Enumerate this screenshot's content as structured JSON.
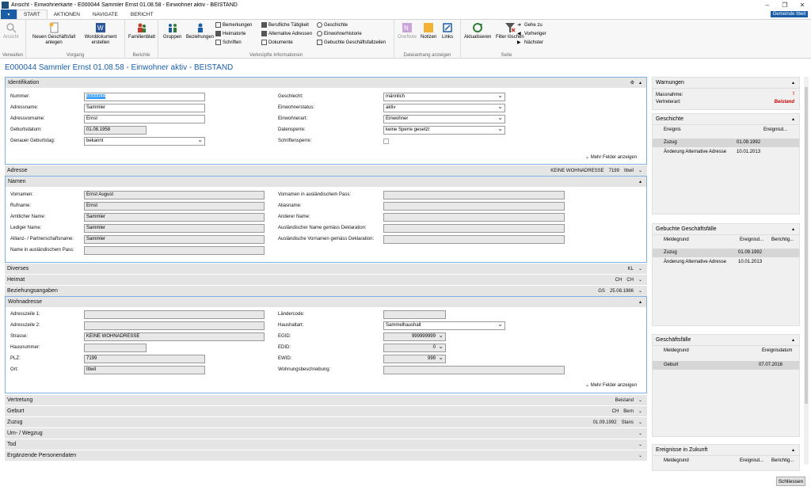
{
  "window": {
    "title": "Ansicht - Einwohnerkarte - E000044 Sammler Ernst 01.08.58 - Einwohner aktiv - BEISTAND",
    "gemeinde": "Gemeinde Ittwil"
  },
  "ribbon": {
    "tabs": [
      "START",
      "AKTIONEN",
      "NAVIGATE",
      "BERICHT"
    ],
    "groups": {
      "verwalten": {
        "label": "Verwalten",
        "ansicht": "Ansicht"
      },
      "vorgang": {
        "label": "Vorgang",
        "neu": "Neuen Geschäftsfall anlegen",
        "word": "Worddokument erstellen"
      },
      "berichte": {
        "label": "Berichte",
        "familienblatt": "Familienblatt"
      },
      "verkn": {
        "label": "Verknüpfte Informationen",
        "gruppen": "Gruppen",
        "beziehungen": "Beziehungen",
        "bemerkungen": "Bemerkungen",
        "heimatorte": "Heimatorte",
        "schriften": "Schriften",
        "taetigkeit": "Berufliche Tätigkeit",
        "altadressen": "Alternative Adressen",
        "dokumente": "Dokumente",
        "geschichte": "Geschichte",
        "einwohnerhistorie": "Einwohnerhistorie",
        "gebuchte": "Gebuchte Geschäftsfallzeilen"
      },
      "dateianhang": {
        "label": "Dateianhang anzeigen",
        "onenote": "OneNote",
        "notizen": "Notizen",
        "links": "Links"
      },
      "seite": {
        "label": "Seite",
        "aktualisieren": "Aktualisieren",
        "filter": "Filter löschen",
        "gehezu": "Gehe zu",
        "vorheriger": "Vorheriger",
        "naechster": "Nächster"
      }
    }
  },
  "page_title": "E000044 Sammler Ernst 01.08.58 - Einwohner aktiv - BEISTAND",
  "identifikation": {
    "title": "Identifikation",
    "nummer_label": "Nummer:",
    "nummer": "E000044",
    "adressname_label": "Adressname:",
    "adressname": "Sammler",
    "adressvorname_label": "Adressvorname:",
    "adressvorname": "Ernst",
    "geburtsdatum_label": "Geburtsdatum:",
    "geburtsdatum": "01.08.1958",
    "genauer_label": "Genauer Geburtstag:",
    "genauer": "bekannt",
    "geschlecht_label": "Geschlecht:",
    "geschlecht": "männlich",
    "status_label": "Einwohnerstatus:",
    "status": "aktiv",
    "art_label": "Einwohnerart:",
    "art": "Einwohner",
    "sperre_label": "Datensperre:",
    "sperre": "keine Sperre gesetzt",
    "schriftensperre_label": "Schriftensperre:",
    "mehr": "Mehr Felder anzeigen"
  },
  "adresse": {
    "title": "Adresse",
    "info": "KEINE WOHNADRESSE",
    "plz": "7199",
    "ort": "Ittwil"
  },
  "namen": {
    "title": "Namen",
    "vornamen_label": "Vornamen:",
    "vornamen": "Ernst August",
    "rufname_label": "Rufname:",
    "rufname": "Ernst",
    "amtlich_label": "Amtlicher Name:",
    "amtlich": "Sammler",
    "ledig_label": "Lediger Name:",
    "ledig": "Sammler",
    "allianz_label": "Allianz- / Partnerschaftsname:",
    "allianz": "Sammler",
    "pass_label": "Name in ausländischem Pass:",
    "vornamen_pass_label": "Vornamen in ausländischem Pass:",
    "alias_label": "Aliasname:",
    "anderer_label": "Anderer Name:",
    "ausl_name_label": "Ausländischer Name gemäss Deklaration:",
    "ausl_vornamen_label": "Ausländische Vornamen gemäss Deklaration:"
  },
  "diverses": {
    "title": "Diverses",
    "info": "KL"
  },
  "heimat": {
    "title": "Heimat",
    "a": "CH",
    "b": "CH"
  },
  "beziehungsangaben": {
    "title": "Beziehungsangaben",
    "a": "GS",
    "b": "25.08.1986"
  },
  "wohnadresse": {
    "title": "Wohnadresse",
    "zeile1_label": "Adresszeile 1:",
    "zeile2_label": "Adresszeile 2:",
    "strasse_label": "Strasse:",
    "strasse": "KEINE WOHNADRESSE",
    "hausnummer_label": "Hausnummer:",
    "plz_label": "PLZ:",
    "plz": "7199",
    "ort_label": "Ort:",
    "ort": "Ittwil",
    "laendercode_label": "Ländercode:",
    "haushaltart_label": "Haushaltart:",
    "haushaltart": "Sammelhaushalt",
    "egid_label": "EGID:",
    "egid": "999999999",
    "edid_label": "EDID:",
    "edid": "0",
    "ewid_label": "EWID:",
    "ewid": "999",
    "wohnungsbeschreibung_label": "Wohnungsbeschreibung:",
    "mehr": "Mehr Felder anzeigen"
  },
  "vertretung": {
    "title": "Vertretung",
    "info": "Beistand"
  },
  "geburt": {
    "title": "Geburt",
    "a": "CH",
    "b": "Bern"
  },
  "zuzug": {
    "title": "Zuzug",
    "a": "01.09.1992",
    "b": "Stans"
  },
  "umzug": {
    "title": "Um- / Wegzug"
  },
  "tod": {
    "title": "Tod"
  },
  "ergaenzende": {
    "title": "Ergänzende Personendaten"
  },
  "side": {
    "warnungen": {
      "title": "Warnungen",
      "massnahme_label": "Massnahme:",
      "massnahme": "!",
      "vertreterart_label": "Vertreterart:",
      "vertreterart": "Beistand"
    },
    "geschichte": {
      "title": "Geschichte",
      "col1": "Ereignis",
      "col2": "Ereignisd...",
      "rows": [
        {
          "a": "Zuzug",
          "b": "01.09.1992"
        },
        {
          "a": "Änderung Alternative Adresse",
          "b": "10.01.2013"
        }
      ]
    },
    "gebuchte": {
      "title": "Gebuchte Geschäftsfälle",
      "col1": "Meldegrund",
      "col2": "Ereignisd...",
      "col3": "Berichtig...",
      "rows": [
        {
          "a": "Zuzug",
          "b": "01.09.1992"
        },
        {
          "a": "Änderung Alternative Adresse",
          "b": "10.01.2013"
        }
      ]
    },
    "geschaeftsfaelle": {
      "title": "Geschäftsfälle",
      "col1": "Meldegrund",
      "col2": "Ereignisdatum",
      "rows": [
        {
          "a": "Geburt",
          "b": "07.07.2016"
        }
      ]
    },
    "zukunft": {
      "title": "Ereignisse in Zukunft",
      "col1": "Meldegrund",
      "col2": "Ereignisd...",
      "col3": "Berichtig..."
    }
  },
  "close_button": "Schliessen"
}
